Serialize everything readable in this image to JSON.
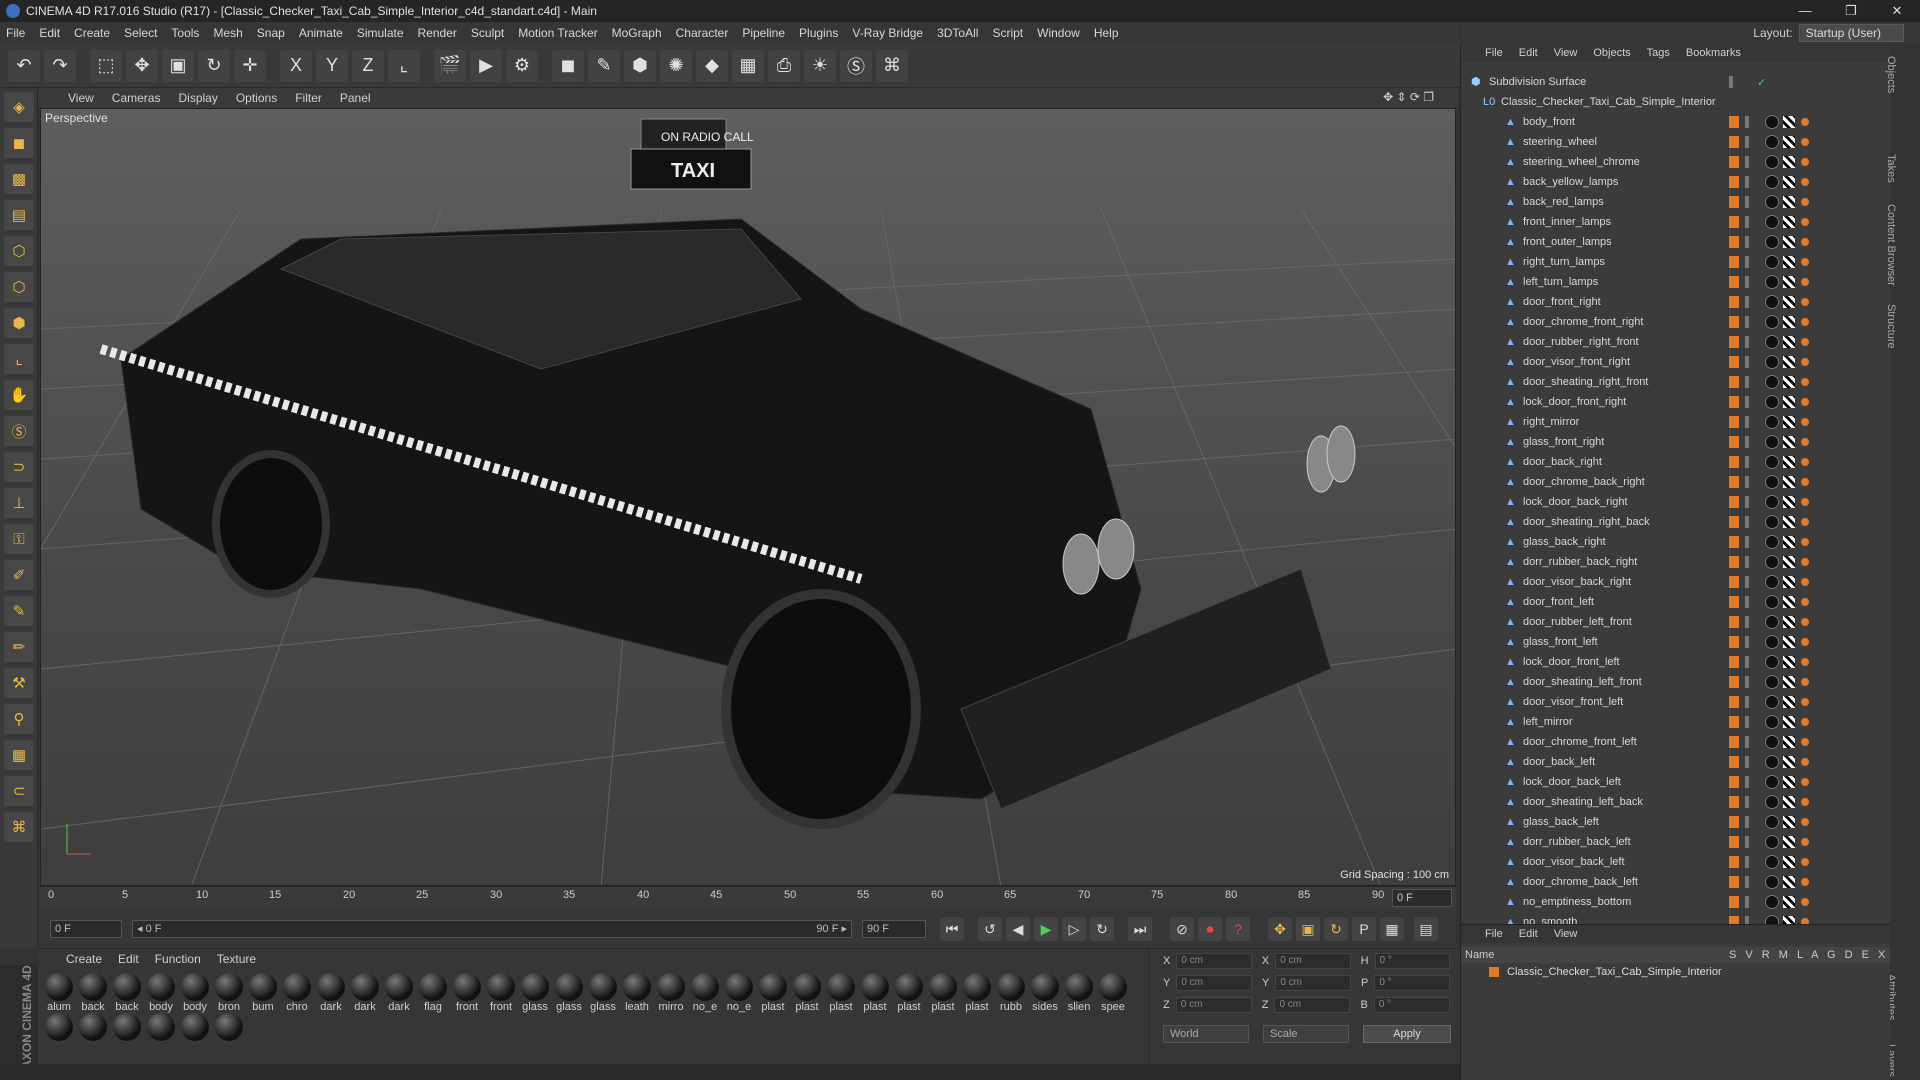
{
  "window": {
    "title": "CINEMA 4D R17.016 Studio (R17) - [Classic_Checker_Taxi_Cab_Simple_Interior_c4d_standart.c4d] - Main",
    "controls": [
      "—",
      "❐",
      "✕"
    ]
  },
  "menu": [
    "File",
    "Edit",
    "Create",
    "Select",
    "Tools",
    "Mesh",
    "Snap",
    "Animate",
    "Simulate",
    "Render",
    "Sculpt",
    "Motion Tracker",
    "MoGraph",
    "Character",
    "Pipeline",
    "Plugins",
    "V-Ray Bridge",
    "3DToAll",
    "Script",
    "Window",
    "Help"
  ],
  "layout": {
    "label": "Layout:",
    "value": "Startup (User)"
  },
  "toolbar": {
    "x": "X",
    "y": "Y",
    "z": "Z"
  },
  "viewport": {
    "menu": [
      "View",
      "Cameras",
      "Display",
      "Options",
      "Filter",
      "Panel"
    ],
    "label": "Perspective",
    "grid_spacing": "Grid Spacing : 100 cm"
  },
  "timeline": {
    "ticks": [
      "0",
      "5",
      "10",
      "15",
      "20",
      "25",
      "30",
      "35",
      "40",
      "45",
      "50",
      "55",
      "60",
      "65",
      "70",
      "75",
      "80",
      "85",
      "90"
    ],
    "frame_end": "0 F"
  },
  "transport": {
    "start": "0 F",
    "range_start": "◂ 0 F",
    "range_end": "90 F ▸",
    "end": "90 F"
  },
  "materials": {
    "menu": [
      "Create",
      "Edit",
      "Function",
      "Texture"
    ],
    "items": [
      "alum",
      "back",
      "back",
      "body",
      "body",
      "bron",
      "bum",
      "chro",
      "dark",
      "dark",
      "dark",
      "flag",
      "front",
      "front",
      "glass",
      "glass",
      "glass",
      "leath",
      "mirro",
      "no_e",
      "no_e",
      "plast",
      "plast",
      "plast",
      "plast",
      "plast",
      "plast",
      "plast",
      "rubb",
      "sides",
      "slien",
      "spee",
      "",
      "",
      "",
      "",
      "",
      ""
    ]
  },
  "maxon_label": "MAXON CINEMA 4D",
  "coords": {
    "rows": [
      [
        "X",
        "0 cm",
        "X",
        "0 cm",
        "H",
        "0 °"
      ],
      [
        "Y",
        "0 cm",
        "Y",
        "0 cm",
        "P",
        "0 °"
      ],
      [
        "Z",
        "0 cm",
        "Z",
        "0 cm",
        "B",
        "0 °"
      ]
    ],
    "world": "World",
    "scale": "Scale",
    "apply": "Apply"
  },
  "objects": {
    "menu": [
      "File",
      "Edit",
      "View",
      "Objects",
      "Tags",
      "Bookmarks"
    ],
    "root": "Subdivision Surface",
    "parent": "Classic_Checker_Taxi_Cab_Simple_Interior",
    "items": [
      "body_front",
      "steering_wheel",
      "steering_wheel_chrome",
      "back_yellow_lamps",
      "back_red_lamps",
      "front_inner_lamps",
      "front_outer_lamps",
      "right_turn_lamps",
      "left_turn_lamps",
      "door_front_right",
      "door_chrome_front_right",
      "door_rubber_right_front",
      "door_visor_front_right",
      "door_sheating_right_front",
      "lock_door_front_right",
      "right_mirror",
      "glass_front_right",
      "door_back_right",
      "door_chrome_back_right",
      "lock_door_back_right",
      "door_sheating_right_back",
      "glass_back_right",
      "dorr_rubber_back_right",
      "door_visor_back_right",
      "door_front_left",
      "door_rubber_left_front",
      "glass_front_left",
      "lock_door_front_left",
      "door_sheating_left_front",
      "door_visor_front_left",
      "left_mirror",
      "door_chrome_front_left",
      "door_back_left",
      "lock_door_back_left",
      "door_sheating_left_back",
      "glass_back_left",
      "dorr_rubber_back_left",
      "door_visor_back_left",
      "door_chrome_back_left",
      "no_emptiness_bottom",
      "no_smooth"
    ]
  },
  "sidetabs": [
    "Objects",
    "Takes",
    "Content Browser",
    "Structure",
    "Attributes",
    "Layers"
  ],
  "attributes": {
    "menu": [
      "File",
      "Edit",
      "View"
    ],
    "header": "Name",
    "header_flags": "S V R M L A G D E X",
    "row": "Classic_Checker_Taxi_Cab_Simple_Interior"
  }
}
